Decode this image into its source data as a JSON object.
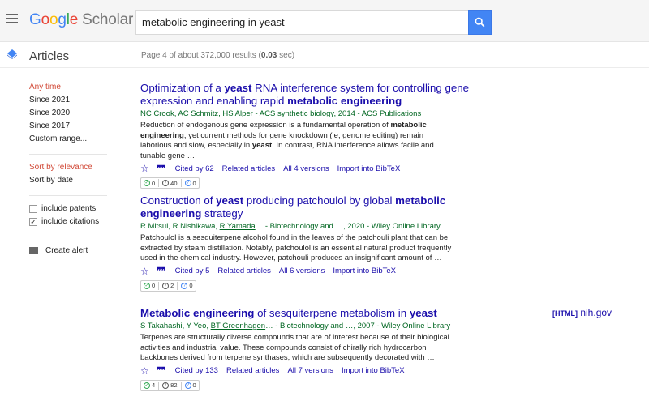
{
  "header": {
    "logo_google": [
      "G",
      "o",
      "o",
      "g",
      "l",
      "e"
    ],
    "logo_scholar": "Scholar",
    "search_value": "metabolic engineering in yeast"
  },
  "subheader": {
    "section_label": "Articles",
    "results_prefix": "Page 4 of about 372,000 results (",
    "results_time": "0.03",
    "results_suffix": " sec)"
  },
  "sidebar": {
    "time_filters": [
      "Any time",
      "Since 2021",
      "Since 2020",
      "Since 2017",
      "Custom range..."
    ],
    "sort_options": [
      "Sort by relevance",
      "Sort by date"
    ],
    "include_patents": "include patents",
    "include_citations": "include citations",
    "create_alert": "Create alert"
  },
  "results": [
    {
      "title_parts": [
        "Optimization of a ",
        "yeast",
        " RNA interference system for controlling gene expression and enabling rapid ",
        "metabolic engineering"
      ],
      "authors": [
        "NC Crook",
        ", AC Schmitz, ",
        "HS Alper",
        " - ACS synthetic biology, 2014 - ACS Publications"
      ],
      "snippet_parts": [
        "Reduction of endogenous gene expression is a fundamental operation of ",
        "metabolic engineering",
        ", yet current methods for gene knockdown (ie, genome editing) remain laborious and slow, especially in ",
        "yeast",
        ". In contrast, RNA interference allows facile and tunable gene …"
      ],
      "cited_by": "Cited by 62",
      "related": "Related articles",
      "versions": "All 4 versions",
      "bibtex": "Import into BibTeX",
      "badges": [
        "0",
        "40",
        "0"
      ]
    },
    {
      "title_parts": [
        "Construction of ",
        "yeast",
        " producing patchoulol by global ",
        "metabolic engineering",
        " strategy"
      ],
      "authors": [
        "R Mitsui, R Nishikawa, ",
        "R Yamada",
        "… - Biotechnology and …, 2020 - Wiley Online Library"
      ],
      "snippet_parts": [
        "Patchoulol is a sesquiterpene alcohol found in the leaves of the patchouli plant that can be extracted by steam distillation. Notably, patchoulol is an essential natural product frequently used in the chemical industry. However, patchouli produces an insignificant amount of …"
      ],
      "cited_by": "Cited by 5",
      "related": "Related articles",
      "versions": "All 6 versions",
      "bibtex": "Import into BibTeX",
      "badges": [
        "0",
        "2",
        "0"
      ]
    },
    {
      "title_parts": [
        "Metabolic engineering",
        " of sesquiterpene metabolism in ",
        "yeast"
      ],
      "authors": [
        "S Takahashi, Y Yeo, ",
        "BT Greenhagen",
        "… - Biotechnology and …, 2007 - Wiley Online Library"
      ],
      "snippet_parts": [
        "Terpenes are structurally diverse compounds that are of interest because of their biological activities and industrial value. These compounds consist of chirally rich hydrocarbon backbones derived from terpene synthases, which are subsequently decorated with …"
      ],
      "cited_by": "Cited by 133",
      "related": "Related articles",
      "versions": "All 7 versions",
      "bibtex": "Import into BibTeX",
      "badges": [
        "4",
        "82",
        "0"
      ],
      "side_link_tag": "[HTML]",
      "side_link_site": "nih.gov"
    }
  ],
  "colors": {
    "accent_blue": "#4285f4",
    "link": "#1a0dab",
    "author_green": "#006621",
    "active_red": "#d14836"
  },
  "icons": [
    "hamburger-icon",
    "search-icon",
    "articles-icon",
    "star-icon",
    "cite-icon",
    "mail-icon"
  ]
}
